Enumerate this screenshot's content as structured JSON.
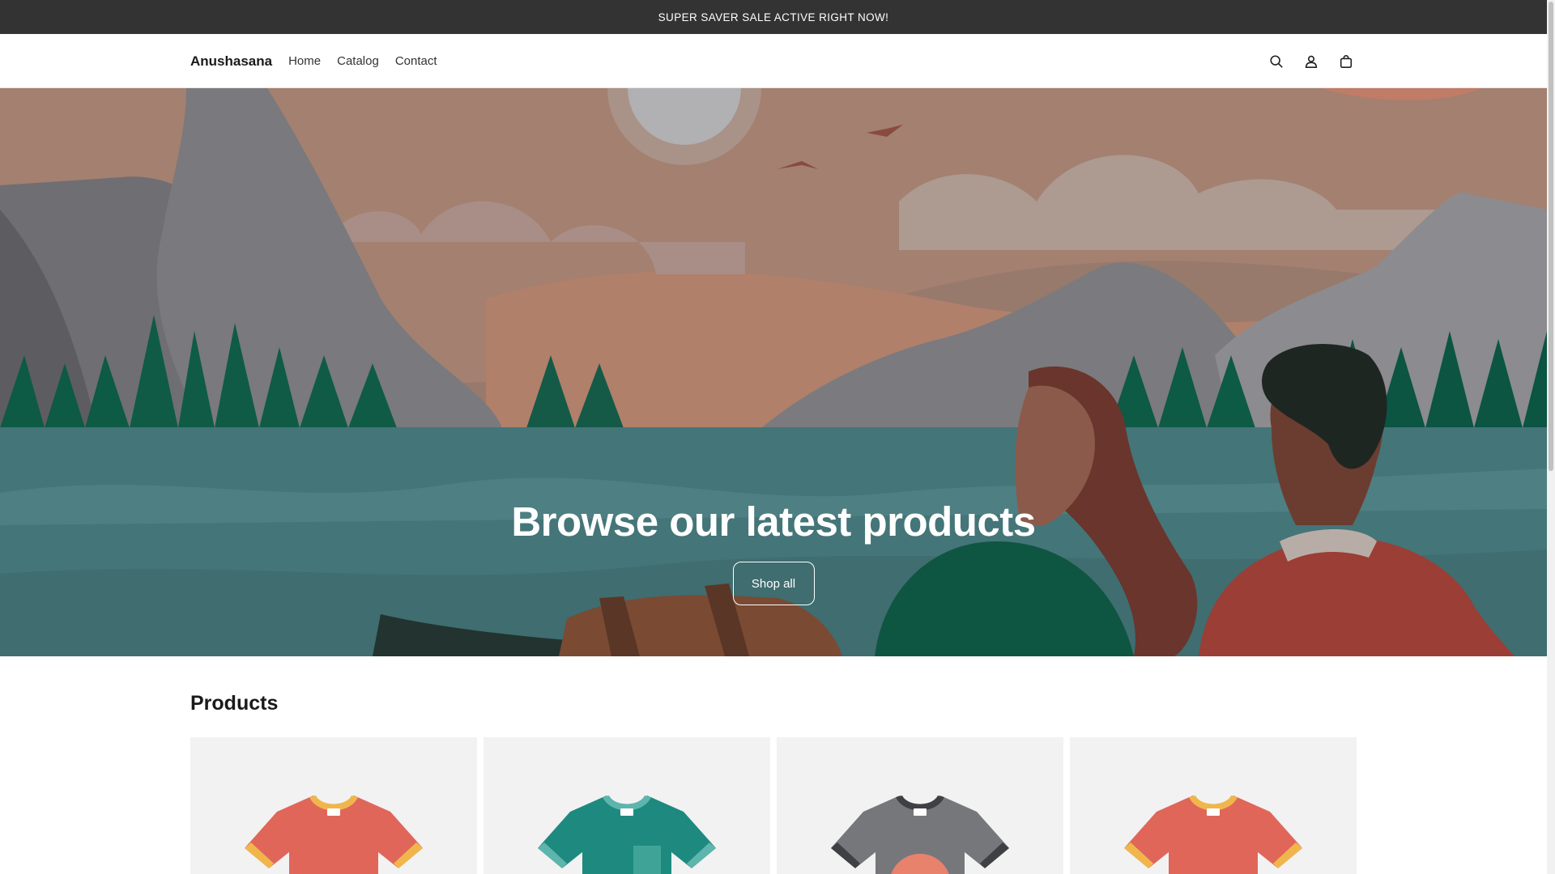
{
  "announcement": {
    "text": "SUPER SAVER SALE ACTIVE RIGHT NOW!"
  },
  "header": {
    "brand": "Anushasana",
    "nav": [
      {
        "label": "Home"
      },
      {
        "label": "Catalog"
      },
      {
        "label": "Contact"
      }
    ],
    "icons": [
      "search-icon",
      "account-icon",
      "cart-icon"
    ]
  },
  "hero": {
    "title": "Browse our latest products",
    "button_label": "Shop all"
  },
  "products": {
    "title": "Products",
    "items": [
      {
        "icon": "tshirt-icon",
        "color": "#e0665a",
        "trim": "#f0b64c"
      },
      {
        "icon": "tshirt-icon",
        "color": "#1e8a7f",
        "trim": "#5db5ad"
      },
      {
        "icon": "tshirt-icon",
        "color": "#76777b",
        "trim": "#3f4044"
      },
      {
        "icon": "tshirt-icon",
        "color": "#e0665a",
        "trim": "#f0b64c"
      }
    ]
  }
}
